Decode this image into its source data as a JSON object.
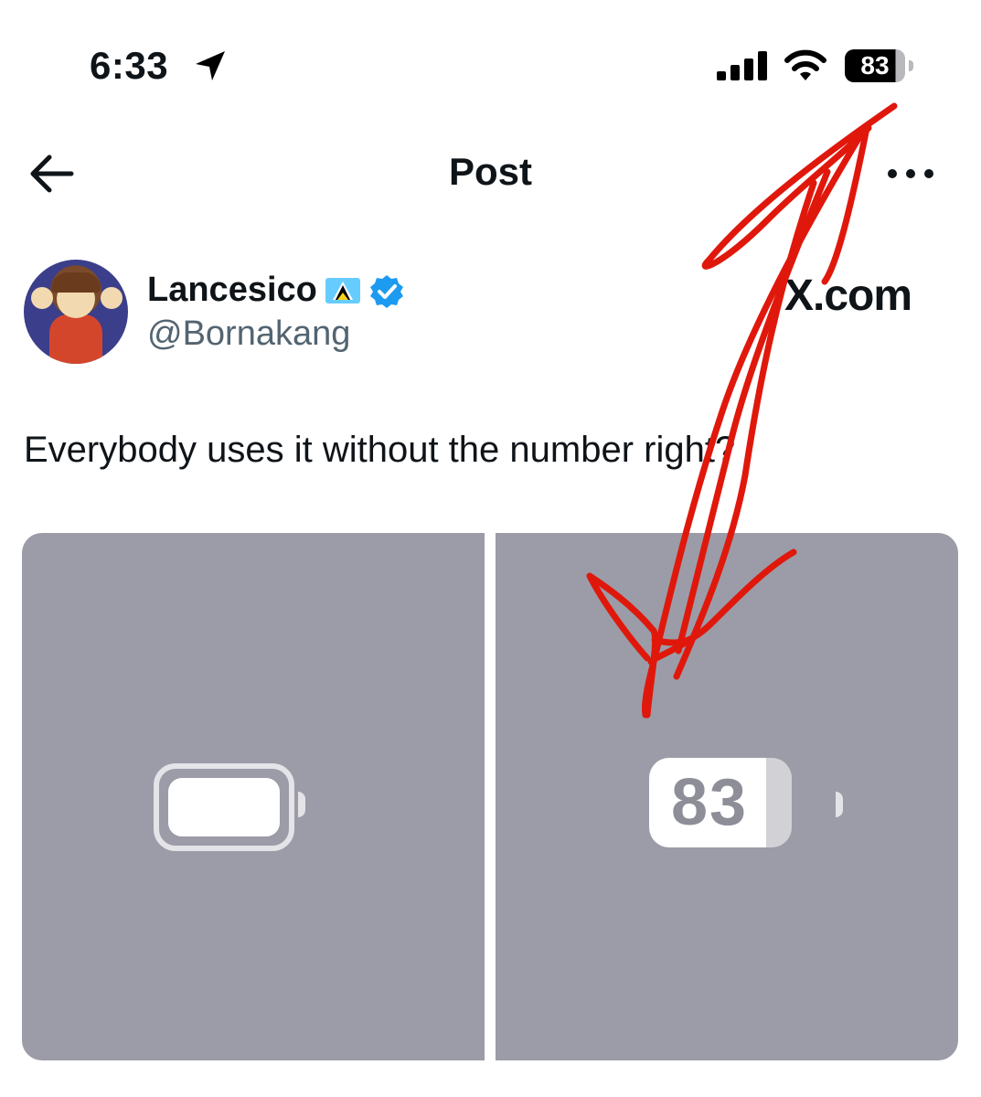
{
  "status_bar": {
    "time": "6:33",
    "battery_level": "83"
  },
  "header": {
    "title": "Post"
  },
  "author": {
    "display_name": "Lancesico",
    "handle": "@Bornakang",
    "verified": true
  },
  "watermark": "X.com",
  "post": {
    "text": "Everybody uses it without the number right?"
  },
  "media": {
    "right_panel_battery_value": "83"
  },
  "icons": [
    "location-arrow-icon",
    "signal-icon",
    "wifi-icon",
    "battery-icon",
    "back-arrow-icon",
    "more-icon",
    "flag-icon",
    "verified-icon"
  ],
  "colors": {
    "annotation_red": "#e0180c",
    "verified_blue": "#1d9bf0",
    "media_bg": "#9b9ca7"
  }
}
